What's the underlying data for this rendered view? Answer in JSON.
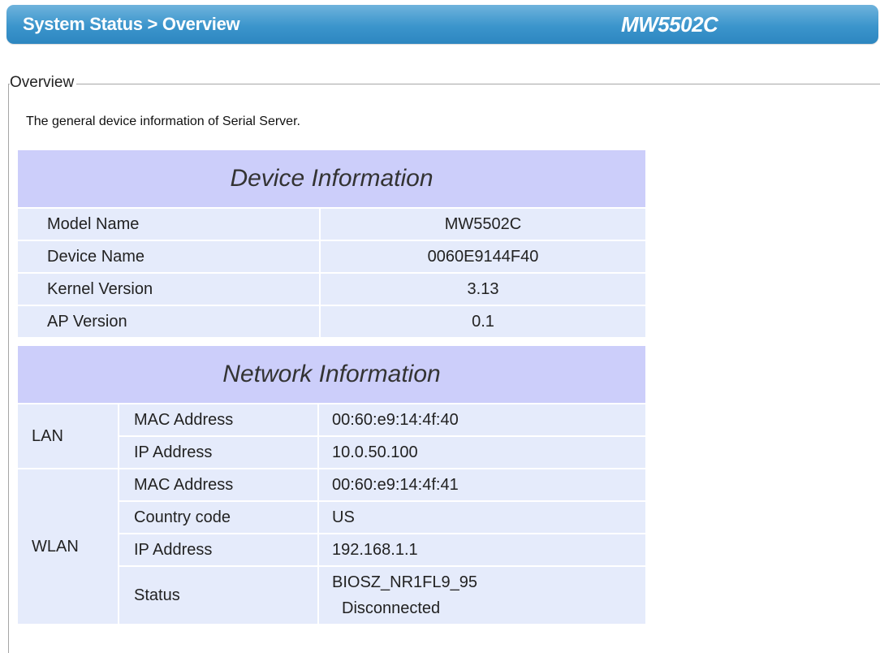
{
  "header": {
    "breadcrumb": "System Status > Overview",
    "model": "MW5502C"
  },
  "overview": {
    "legend": "Overview",
    "description": "The general device information of Serial Server."
  },
  "device_info": {
    "title": "Device Information",
    "rows": [
      {
        "label": "Model Name",
        "value": "MW5502C"
      },
      {
        "label": "Device Name",
        "value": "0060E9144F40"
      },
      {
        "label": "Kernel Version",
        "value": "3.13"
      },
      {
        "label": "AP Version",
        "value": "0.1"
      }
    ]
  },
  "network_info": {
    "title": "Network Information",
    "lan": {
      "label": "LAN",
      "mac_label": "MAC Address",
      "mac_value": "00:60:e9:14:4f:40",
      "ip_label": "IP Address",
      "ip_value": "10.0.50.100"
    },
    "wlan": {
      "label": "WLAN",
      "mac_label": "MAC Address",
      "mac_value": "00:60:e9:14:4f:41",
      "country_label": "Country code",
      "country_value": "US",
      "ip_label": "IP Address",
      "ip_value": "192.168.1.1",
      "status_label": "Status",
      "status_ssid": "BIOSZ_NR1FL9_95",
      "status_state": "Disconnected"
    }
  }
}
